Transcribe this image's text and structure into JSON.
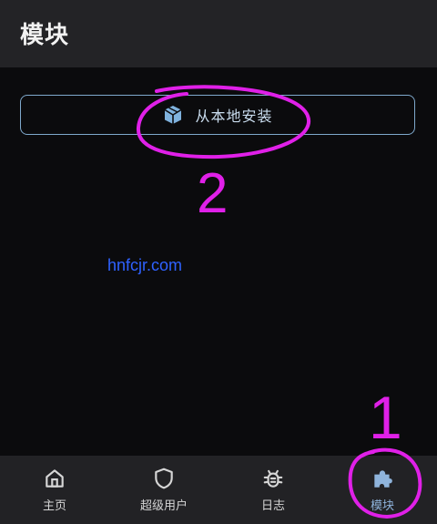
{
  "header": {
    "title": "模块"
  },
  "main": {
    "install_button": {
      "label": "从本地安装"
    },
    "watermark": "hnfcjr.com"
  },
  "nav": {
    "items": [
      {
        "label": "主页",
        "icon": "home-icon",
        "active": false
      },
      {
        "label": "超级用户",
        "icon": "shield-icon",
        "active": false
      },
      {
        "label": "日志",
        "icon": "bug-icon",
        "active": false
      },
      {
        "label": "模块",
        "icon": "puzzle-icon",
        "active": true
      }
    ]
  },
  "annotations": {
    "numbers": [
      "2",
      "1"
    ],
    "color": "#e020e8"
  },
  "colors": {
    "accent": "#8fb4dc",
    "button_border": "#7fa9cc"
  }
}
